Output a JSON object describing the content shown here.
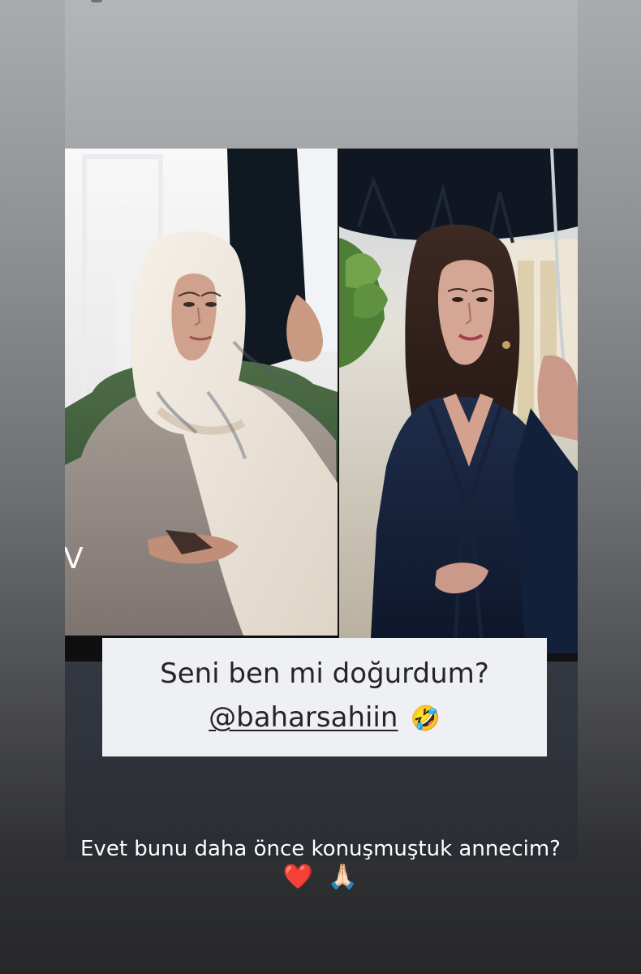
{
  "story": {
    "caption_title": "Seni ben mi doğurdum?",
    "caption_handle": "@baharsahiin",
    "caption_emoji": "🤣",
    "bottom_caption": "Evet bunu daha önce konuşmuştuk annecim?",
    "bottom_emojis": [
      "❤️",
      "🙏🏻"
    ]
  },
  "photo": {
    "left_overlay_text": "V",
    "left_image_icon": "woman-headscarf-portrait-icon",
    "right_image_icon": "woman-umbrella-portrait-icon"
  },
  "colors": {
    "caption_background": "#eef0f4",
    "page_text": "#ffffff",
    "caption_text": "#242424"
  }
}
